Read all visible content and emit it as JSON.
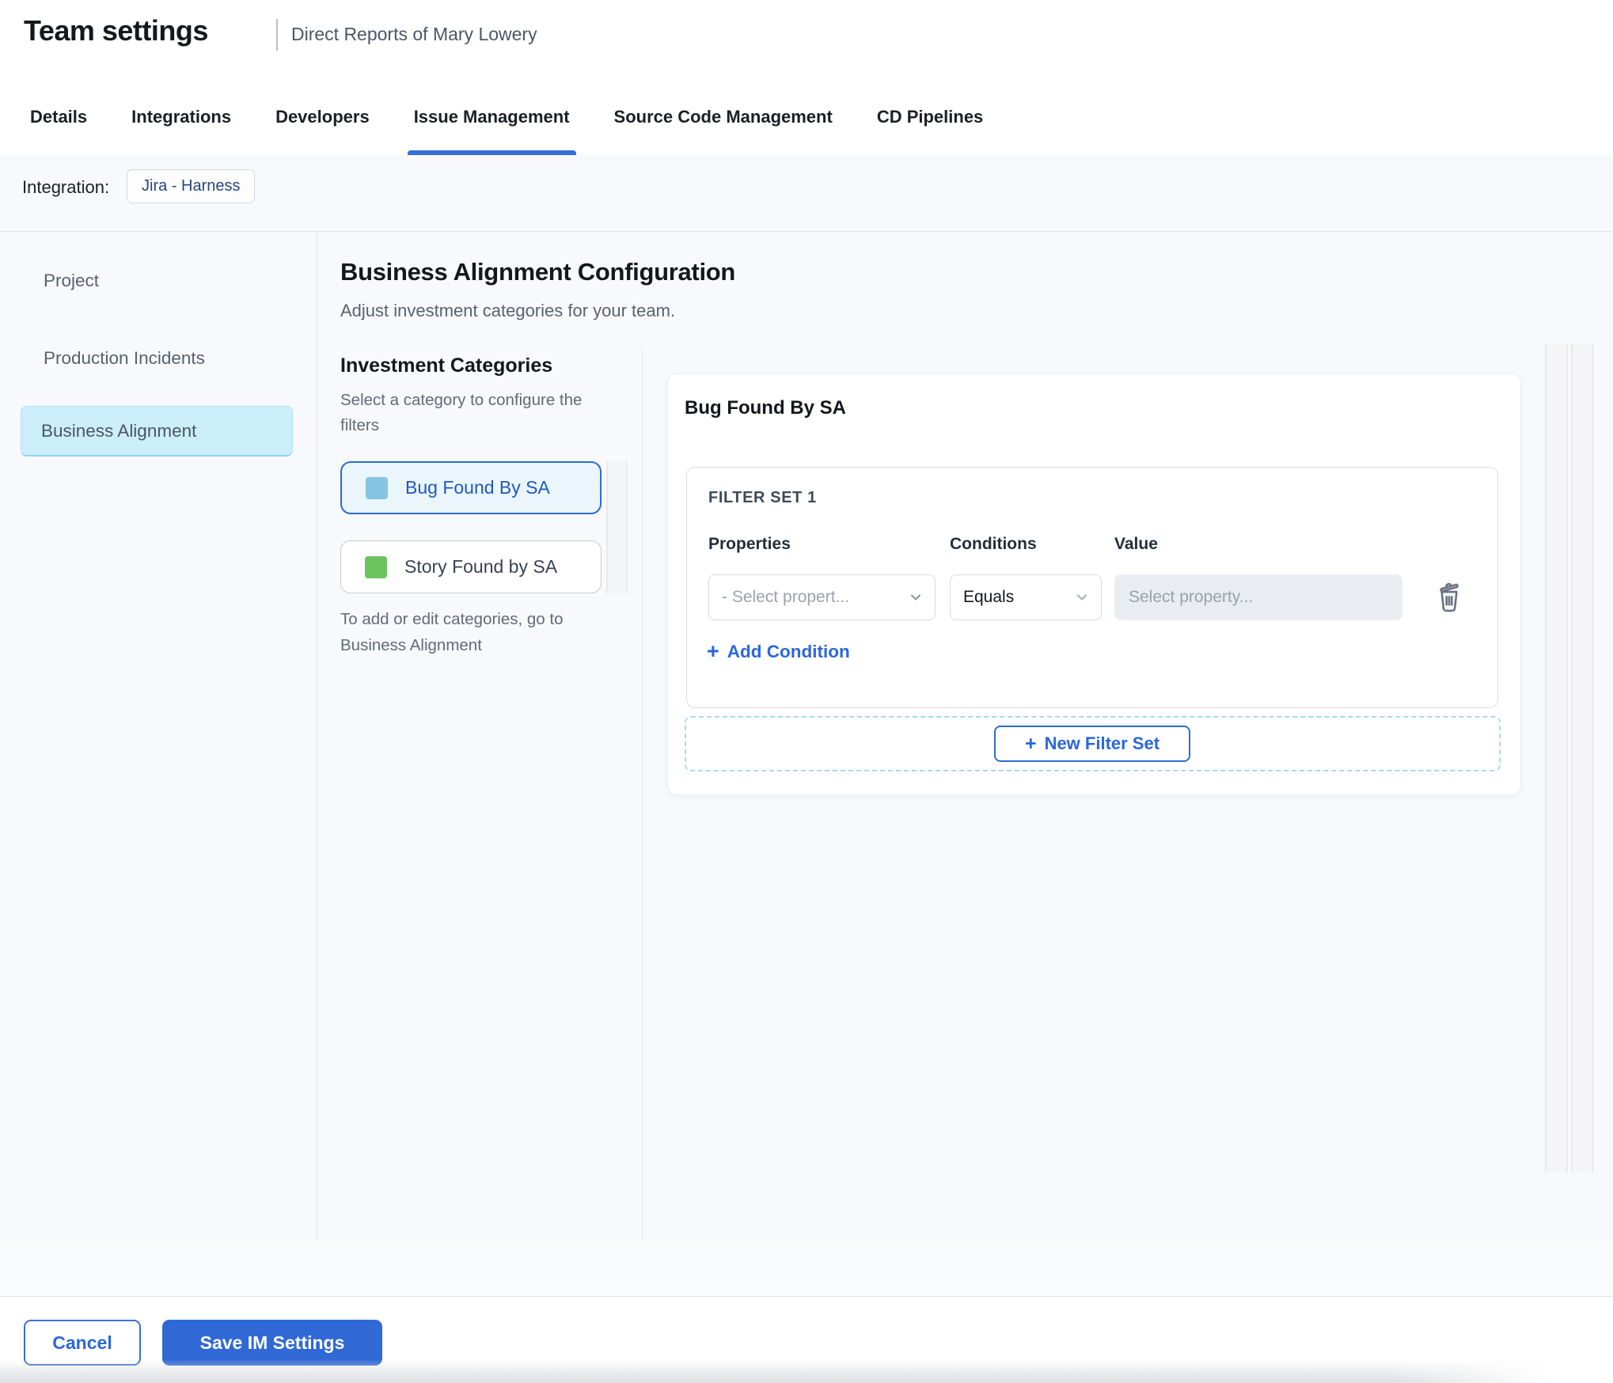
{
  "header": {
    "title": "Team settings",
    "subtitle": "Direct Reports of Mary Lowery"
  },
  "tabs": {
    "items": [
      {
        "label": "Details",
        "active": false
      },
      {
        "label": "Integrations",
        "active": false
      },
      {
        "label": "Developers",
        "active": false
      },
      {
        "label": "Issue Management",
        "active": true
      },
      {
        "label": "Source Code Management",
        "active": false
      },
      {
        "label": "CD Pipelines",
        "active": false
      }
    ]
  },
  "integration": {
    "label": "Integration:",
    "chip": "Jira - Harness"
  },
  "sidebar": {
    "items": [
      {
        "label": "Project",
        "selected": false
      },
      {
        "label": "Production Incidents",
        "selected": false
      },
      {
        "label": "Business Alignment",
        "selected": true
      }
    ]
  },
  "main": {
    "title": "Business Alignment Configuration",
    "subtitle": "Adjust investment categories for your team.",
    "categories": {
      "heading": "Investment Categories",
      "hint": "Select a category to configure the filters",
      "items": [
        {
          "label": "Bug Found By SA",
          "color": "#85c4e4",
          "selected": true
        },
        {
          "label": "Story Found by SA",
          "color": "#6cc35f",
          "selected": false
        }
      ],
      "footnote": "To add or edit categories, go to Business Alignment"
    },
    "panel": {
      "title": "Bug Found By SA",
      "filter_set": {
        "title": "FILTER SET 1",
        "columns": [
          "Properties",
          "Conditions",
          "Value"
        ],
        "property_placeholder": "- Select propert...",
        "condition_value": "Equals",
        "value_placeholder": "Select property...",
        "add_condition_label": "Add Condition"
      },
      "new_filter_set_label": "New Filter Set"
    }
  },
  "footer": {
    "cancel_label": "Cancel",
    "save_label": "Save IM Settings"
  },
  "icons": {
    "plus": "+",
    "chevron_down": "chevron-down",
    "trash": "trash"
  },
  "colors": {
    "accent_blue": "#2b66dd",
    "tab_underline": "#3570d8",
    "save_button_bg": "#3069d6",
    "sidebar_selected_bg": "#cbeefa",
    "selected_category_border": "#2e6bd0",
    "category_swatch_blue": "#85c4e4",
    "category_swatch_green": "#6cc35f",
    "dashed_border": "#a9d9ec"
  }
}
